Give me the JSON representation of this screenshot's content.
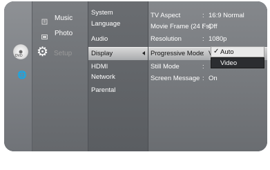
{
  "source_menu": {
    "items": [
      {
        "label": "Music",
        "icon": "music-icon"
      },
      {
        "label": "Photo",
        "icon": "photo-icon"
      }
    ],
    "disc_label": "DVD"
  },
  "main_menu": {
    "setup_label": "Setup"
  },
  "sub_menu": {
    "items": [
      "System",
      "Language",
      "Audio",
      "Display",
      "HDMI",
      "Network",
      "Parental"
    ]
  },
  "settings": {
    "rows": [
      {
        "name": "TV Aspect",
        "sep": ":",
        "value": "16:9 Normal"
      },
      {
        "name": "Movie Frame (24 Fs)",
        "sep": ":",
        "value": "Off"
      },
      {
        "name": "Resolution",
        "sep": ":",
        "value": "1080p"
      },
      {
        "name": "Progressive Mode",
        "sep": ":",
        "value": "V"
      },
      {
        "name": "Still Mode",
        "sep": ":",
        "value": ""
      },
      {
        "name": "Screen Message",
        "sep": ":",
        "value": "On"
      }
    ]
  },
  "dropdown": {
    "options": [
      "Auto",
      "Video"
    ],
    "checked_mark": "✓"
  }
}
